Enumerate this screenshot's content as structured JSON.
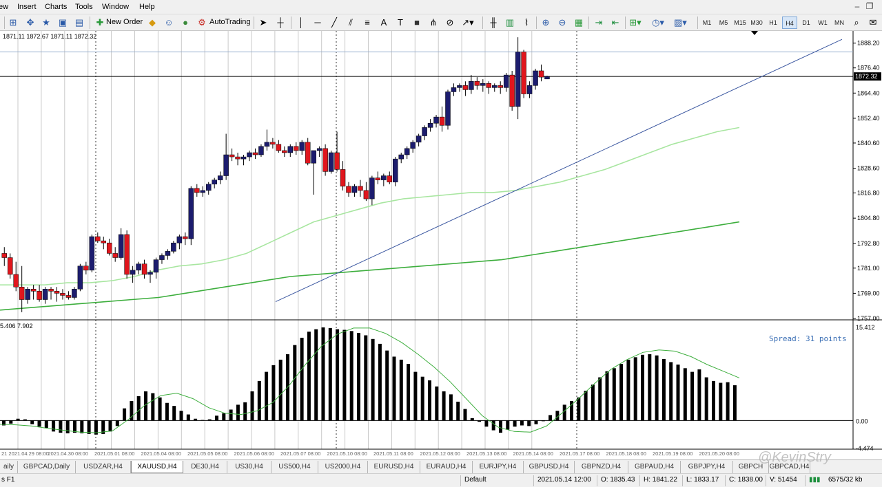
{
  "menu": {
    "items": [
      "ew",
      "Insert",
      "Charts",
      "Tools",
      "Window",
      "Help"
    ]
  },
  "toolbar": {
    "new_order_label": "New Order",
    "autotrading_label": "AutoTrading",
    "timeframes": [
      "M1",
      "M5",
      "M15",
      "M30",
      "H1",
      "H4",
      "D1",
      "W1",
      "MN"
    ],
    "active_timeframe": "H4"
  },
  "chart": {
    "ohlc_text": "1871.11 1872.67 1871.11 1872.32",
    "current_price_label": "1872.32",
    "spread_text": "Spread: 31 points",
    "price_ticks": [
      "1888.20",
      "1876.40",
      "1864.40",
      "1852.40",
      "1840.60",
      "1828.60",
      "1816.80",
      "1804.80",
      "1792.80",
      "1781.00",
      "1769.00",
      "1757.00"
    ],
    "indicator_text": "5.406 7.902",
    "indicator_ticks": [
      "15.412",
      "0.00",
      "-4.474"
    ],
    "colors": {
      "bull": "#1c1c6e",
      "bear": "#e0161d",
      "ma_fast": "#a8e6a0",
      "ma_slow": "#3dae3d",
      "trendline": "#3b57a0",
      "histogram": "#000000",
      "signal": "#3dae3d"
    }
  },
  "chart_data": [
    {
      "type": "candlestick",
      "title": "XAUUSD,H4",
      "ylim": [
        1757,
        1894
      ],
      "candles": [
        {
          "o": 1788,
          "h": 1791,
          "l": 1782,
          "c": 1786
        },
        {
          "o": 1786,
          "h": 1788,
          "l": 1776,
          "c": 1778
        },
        {
          "o": 1778,
          "h": 1784,
          "l": 1770,
          "c": 1772
        },
        {
          "o": 1772,
          "h": 1782,
          "l": 1760,
          "c": 1766
        },
        {
          "o": 1766,
          "h": 1772,
          "l": 1764,
          "c": 1771
        },
        {
          "o": 1771,
          "h": 1773,
          "l": 1766,
          "c": 1770
        },
        {
          "o": 1770,
          "h": 1773,
          "l": 1765,
          "c": 1766
        },
        {
          "o": 1766,
          "h": 1772,
          "l": 1764,
          "c": 1771
        },
        {
          "o": 1771,
          "h": 1772,
          "l": 1766,
          "c": 1770
        },
        {
          "o": 1770,
          "h": 1772,
          "l": 1765,
          "c": 1769
        },
        {
          "o": 1769,
          "h": 1771,
          "l": 1766,
          "c": 1768
        },
        {
          "o": 1768,
          "h": 1770,
          "l": 1766,
          "c": 1767
        },
        {
          "o": 1767,
          "h": 1772,
          "l": 1766,
          "c": 1771
        },
        {
          "o": 1771,
          "h": 1783,
          "l": 1770,
          "c": 1782
        },
        {
          "o": 1782,
          "h": 1784,
          "l": 1778,
          "c": 1780
        },
        {
          "o": 1780,
          "h": 1797,
          "l": 1779,
          "c": 1796
        },
        {
          "o": 1796,
          "h": 1798,
          "l": 1793,
          "c": 1794
        },
        {
          "o": 1794,
          "h": 1796,
          "l": 1790,
          "c": 1793
        },
        {
          "o": 1793,
          "h": 1795,
          "l": 1787,
          "c": 1788
        },
        {
          "o": 1788,
          "h": 1791,
          "l": 1784,
          "c": 1786
        },
        {
          "o": 1786,
          "h": 1800,
          "l": 1785,
          "c": 1797
        },
        {
          "o": 1797,
          "h": 1799,
          "l": 1776,
          "c": 1778
        },
        {
          "o": 1778,
          "h": 1782,
          "l": 1774,
          "c": 1780
        },
        {
          "o": 1780,
          "h": 1784,
          "l": 1778,
          "c": 1783
        },
        {
          "o": 1783,
          "h": 1785,
          "l": 1776,
          "c": 1778
        },
        {
          "o": 1778,
          "h": 1780,
          "l": 1774,
          "c": 1779
        },
        {
          "o": 1779,
          "h": 1786,
          "l": 1776,
          "c": 1785
        },
        {
          "o": 1785,
          "h": 1788,
          "l": 1783,
          "c": 1787
        },
        {
          "o": 1787,
          "h": 1790,
          "l": 1785,
          "c": 1789
        },
        {
          "o": 1789,
          "h": 1794,
          "l": 1788,
          "c": 1793
        },
        {
          "o": 1793,
          "h": 1797,
          "l": 1790,
          "c": 1796
        },
        {
          "o": 1796,
          "h": 1798,
          "l": 1792,
          "c": 1795
        },
        {
          "o": 1795,
          "h": 1820,
          "l": 1792,
          "c": 1819
        },
        {
          "o": 1819,
          "h": 1821,
          "l": 1815,
          "c": 1817
        },
        {
          "o": 1817,
          "h": 1820,
          "l": 1815,
          "c": 1818
        },
        {
          "o": 1818,
          "h": 1822,
          "l": 1816,
          "c": 1821
        },
        {
          "o": 1821,
          "h": 1824,
          "l": 1819,
          "c": 1823
        },
        {
          "o": 1823,
          "h": 1827,
          "l": 1821,
          "c": 1825
        },
        {
          "o": 1825,
          "h": 1845,
          "l": 1823,
          "c": 1835
        },
        {
          "o": 1835,
          "h": 1838,
          "l": 1832,
          "c": 1834
        },
        {
          "o": 1834,
          "h": 1836,
          "l": 1830,
          "c": 1833
        },
        {
          "o": 1833,
          "h": 1835,
          "l": 1830,
          "c": 1834
        },
        {
          "o": 1834,
          "h": 1837,
          "l": 1832,
          "c": 1836
        },
        {
          "o": 1836,
          "h": 1838,
          "l": 1833,
          "c": 1835
        },
        {
          "o": 1835,
          "h": 1840,
          "l": 1834,
          "c": 1839
        },
        {
          "o": 1839,
          "h": 1847,
          "l": 1837,
          "c": 1841
        },
        {
          "o": 1841,
          "h": 1843,
          "l": 1838,
          "c": 1840
        },
        {
          "o": 1840,
          "h": 1842,
          "l": 1836,
          "c": 1837
        },
        {
          "o": 1837,
          "h": 1839,
          "l": 1834,
          "c": 1836
        },
        {
          "o": 1836,
          "h": 1840,
          "l": 1834,
          "c": 1839
        },
        {
          "o": 1839,
          "h": 1841,
          "l": 1835,
          "c": 1837
        },
        {
          "o": 1837,
          "h": 1842,
          "l": 1835,
          "c": 1841
        },
        {
          "o": 1841,
          "h": 1843,
          "l": 1830,
          "c": 1831
        },
        {
          "o": 1831,
          "h": 1836,
          "l": 1816,
          "c": 1837
        },
        {
          "o": 1837,
          "h": 1839,
          "l": 1834,
          "c": 1838
        },
        {
          "o": 1838,
          "h": 1840,
          "l": 1825,
          "c": 1827
        },
        {
          "o": 1827,
          "h": 1837,
          "l": 1826,
          "c": 1836
        },
        {
          "o": 1836,
          "h": 1846,
          "l": 1827,
          "c": 1828
        },
        {
          "o": 1828,
          "h": 1832,
          "l": 1818,
          "c": 1820
        },
        {
          "o": 1820,
          "h": 1822,
          "l": 1815,
          "c": 1817
        },
        {
          "o": 1817,
          "h": 1821,
          "l": 1815,
          "c": 1820
        },
        {
          "o": 1820,
          "h": 1823,
          "l": 1815,
          "c": 1818
        },
        {
          "o": 1818,
          "h": 1822,
          "l": 1813,
          "c": 1814
        },
        {
          "o": 1814,
          "h": 1825,
          "l": 1811,
          "c": 1824
        },
        {
          "o": 1824,
          "h": 1827,
          "l": 1821,
          "c": 1823
        },
        {
          "o": 1823,
          "h": 1826,
          "l": 1820,
          "c": 1825
        },
        {
          "o": 1825,
          "h": 1827,
          "l": 1821,
          "c": 1822
        },
        {
          "o": 1822,
          "h": 1834,
          "l": 1820,
          "c": 1833
        },
        {
          "o": 1833,
          "h": 1836,
          "l": 1831,
          "c": 1835
        },
        {
          "o": 1835,
          "h": 1839,
          "l": 1833,
          "c": 1838
        },
        {
          "o": 1838,
          "h": 1842,
          "l": 1836,
          "c": 1841
        },
        {
          "o": 1841,
          "h": 1845,
          "l": 1839,
          "c": 1844
        },
        {
          "o": 1844,
          "h": 1849,
          "l": 1842,
          "c": 1848
        },
        {
          "o": 1848,
          "h": 1852,
          "l": 1846,
          "c": 1850
        },
        {
          "o": 1850,
          "h": 1854,
          "l": 1848,
          "c": 1853
        },
        {
          "o": 1853,
          "h": 1858,
          "l": 1846,
          "c": 1849
        },
        {
          "o": 1849,
          "h": 1866,
          "l": 1847,
          "c": 1865
        },
        {
          "o": 1865,
          "h": 1869,
          "l": 1863,
          "c": 1867
        },
        {
          "o": 1867,
          "h": 1869,
          "l": 1865,
          "c": 1868
        },
        {
          "o": 1868,
          "h": 1870,
          "l": 1863,
          "c": 1866
        },
        {
          "o": 1866,
          "h": 1873,
          "l": 1864,
          "c": 1870
        },
        {
          "o": 1870,
          "h": 1872,
          "l": 1866,
          "c": 1868
        },
        {
          "o": 1868,
          "h": 1871,
          "l": 1865,
          "c": 1869
        },
        {
          "o": 1869,
          "h": 1870,
          "l": 1864,
          "c": 1867
        },
        {
          "o": 1867,
          "h": 1869,
          "l": 1865,
          "c": 1868
        },
        {
          "o": 1868,
          "h": 1870,
          "l": 1864,
          "c": 1867
        },
        {
          "o": 1867,
          "h": 1874,
          "l": 1865,
          "c": 1873
        },
        {
          "o": 1873,
          "h": 1875,
          "l": 1856,
          "c": 1858
        },
        {
          "o": 1858,
          "h": 1891,
          "l": 1852,
          "c": 1884
        },
        {
          "o": 1884,
          "h": 1885,
          "l": 1862,
          "c": 1864
        },
        {
          "o": 1864,
          "h": 1870,
          "l": 1862,
          "c": 1868
        },
        {
          "o": 1868,
          "h": 1876,
          "l": 1866,
          "c": 1875
        },
        {
          "o": 1875,
          "h": 1878,
          "l": 1870,
          "c": 1872
        },
        {
          "o": 1871.11,
          "h": 1872.67,
          "l": 1871.11,
          "c": 1872.32
        }
      ],
      "ma_fast": [
        1773,
        1773,
        1773,
        1774,
        1774,
        1775,
        1777,
        1780,
        1782,
        1783,
        1785,
        1788,
        1793,
        1798,
        1803,
        1806,
        1809,
        1812,
        1814,
        1815,
        1816,
        1817,
        1817,
        1818,
        1820,
        1822,
        1825,
        1828,
        1832,
        1836,
        1840,
        1843,
        1846,
        1848
      ],
      "ma_slow": [
        1761,
        1762,
        1763,
        1764,
        1765,
        1766,
        1767,
        1769,
        1771,
        1773,
        1775,
        1777,
        1778,
        1779,
        1780,
        1781,
        1782,
        1783,
        1784,
        1785,
        1787,
        1789,
        1791,
        1793,
        1795,
        1797,
        1799,
        1801,
        1803
      ],
      "trendline": {
        "from": 1765,
        "to": 1890
      },
      "current_price": 1872.32
    },
    {
      "type": "bar",
      "title": "MACD",
      "ylim": [
        -4.474,
        15.412
      ],
      "values": [
        -0.8,
        -0.5,
        0.3,
        0.2,
        -0.6,
        -1.0,
        -1.2,
        -1.8,
        -2.0,
        -2.1,
        -2.0,
        -2.1,
        -2.2,
        -2.3,
        -2.2,
        -1.8,
        -0.9,
        2.0,
        3.2,
        4.0,
        4.8,
        4.5,
        3.8,
        2.9,
        2.4,
        1.6,
        1.0,
        0.3,
        0.1,
        0.2,
        0.8,
        1.2,
        1.8,
        2.6,
        3.0,
        4.8,
        6.5,
        8.0,
        9.1,
        10.0,
        10.9,
        12.4,
        13.6,
        14.6,
        15.0,
        15.3,
        15.2,
        15.0,
        14.9,
        14.7,
        14.4,
        14.0,
        13.4,
        12.6,
        11.5,
        10.5,
        10.0,
        9.3,
        8.0,
        7.2,
        6.6,
        5.6,
        4.8,
        4.3,
        3.1,
        1.9,
        0.4,
        -0.2,
        -1.0,
        -1.6,
        -2.0,
        -1.5,
        -1.0,
        -0.8,
        -0.9,
        -0.6,
        0.0,
        0.9,
        1.6,
        2.6,
        3.2,
        3.8,
        4.9,
        5.9,
        7.1,
        8.1,
        8.6,
        9.3,
        10.0,
        10.4,
        10.8,
        10.9,
        10.7,
        10.1,
        9.6,
        9.2,
        8.6,
        8.0,
        8.4,
        7.1,
        6.5,
        6.2,
        6.3,
        5.8
      ],
      "signal": [
        -0.6,
        -0.7,
        -0.9,
        -1.3,
        -1.6,
        -1.9,
        -2.0,
        -1.7,
        0.2,
        2.5,
        4.1,
        4.5,
        3.6,
        2.1,
        1.2,
        1.0,
        1.6,
        3.0,
        5.8,
        9.2,
        12.2,
        14.2,
        15.2,
        15.2,
        14.3,
        12.8,
        10.9,
        8.8,
        6.4,
        3.6,
        0.8,
        -1.1,
        -1.8,
        -1.9,
        -0.9,
        1.3,
        3.6,
        6.1,
        8.4,
        10.0,
        11.2,
        11.6,
        11.4,
        10.5,
        9.2,
        8.1,
        7.0
      ]
    }
  ],
  "x_axis_labels": [
    "21 2021.04.29 08:00",
    "2021.04.30 08:00",
    "2021.05.01 08:00",
    "2021.05.04 08:00",
    "2021.05.05 08:00",
    "2021.05.06 08:00",
    "2021.05.07 08:00",
    "2021.05.10 08:00",
    "2021.05.11 08:00",
    "2021.05.12 08:00",
    "2021.05.13 08:00",
    "2021.05.14 08:00",
    "2021.05.17 08:00",
    "2021.05.18 08:00",
    "2021.05.19 08:00",
    "2021.05.20 08:00"
  ],
  "tabs": [
    {
      "label": "aily",
      "active": false
    },
    {
      "label": "GBPCAD,Daily",
      "active": false
    },
    {
      "label": "USDZAR,H4",
      "active": false
    },
    {
      "label": "XAUUSD,H4",
      "active": true
    },
    {
      "label": "DE30,H4",
      "active": false
    },
    {
      "label": "US30,H4",
      "active": false
    },
    {
      "label": "US500,H4",
      "active": false
    },
    {
      "label": "US2000,H4",
      "active": false
    },
    {
      "label": "EURUSD,H4",
      "active": false
    },
    {
      "label": "EURAUD,H4",
      "active": false
    },
    {
      "label": "EURJPY,H4",
      "active": false
    },
    {
      "label": "GBPUSD,H4",
      "active": false
    },
    {
      "label": "GBPNZD,H4",
      "active": false
    },
    {
      "label": "GBPAUD,H4",
      "active": false
    },
    {
      "label": "GBPJPY,H4",
      "active": false
    },
    {
      "label": "GBPCH",
      "active": false
    },
    {
      "label": "GBPCAD,H4",
      "active": false
    }
  ],
  "status": {
    "help": "s F1",
    "profile": "Default",
    "datetime": "2021.05.14 12:00",
    "open": "O: 1835.43",
    "high": "H: 1841.22",
    "low": "L: 1833.17",
    "close": "C: 1838.00",
    "volume": "V: 51454",
    "traffic": "6575/32 kb"
  },
  "watermark": "@KevinStry"
}
